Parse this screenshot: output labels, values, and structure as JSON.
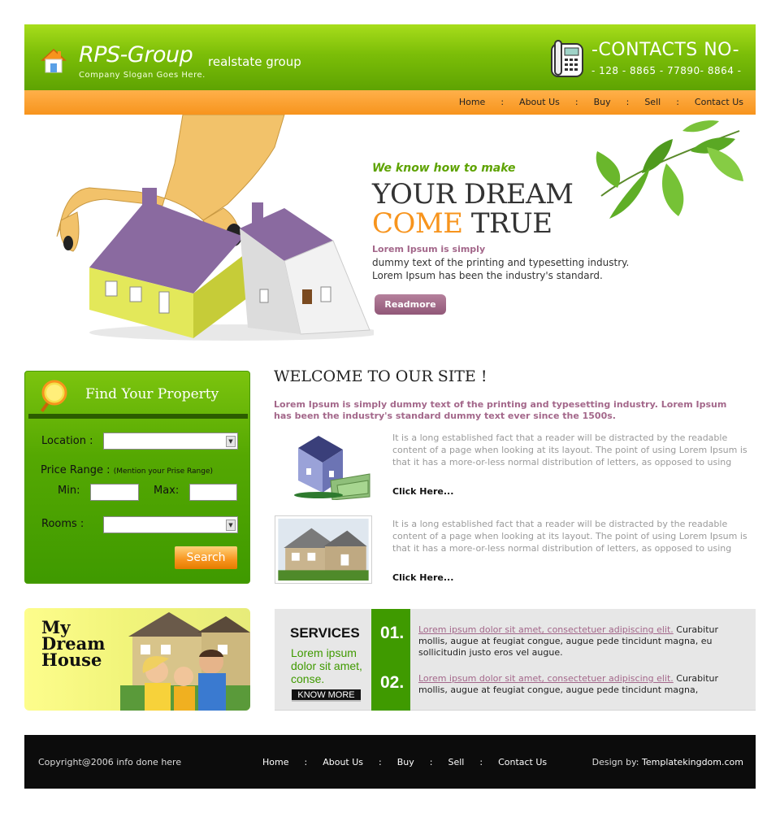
{
  "header": {
    "brand": "RPS-Group",
    "brand_sub": "realstate group",
    "slogan": "Company Slogan Goes Here.",
    "contacts_title": "-CONTACTS NO-",
    "contacts_number": "- 128 - 8865 - 77890- 8864 -"
  },
  "nav": [
    "Home",
    "About Us",
    "Buy",
    "Sell",
    "Contact Us"
  ],
  "hero": {
    "tagline": "We know how to make",
    "line1": "YOUR DREAM",
    "line2_orange": "COME",
    "line2_rest": " TRUE",
    "lorem_heading": "Lorem Ipsum is simply",
    "lorem_line1": "dummy text of the printing and typesetting industry.",
    "lorem_line2": "Lorem Ipsum has been the industry's standard.",
    "readmore": "Readmore"
  },
  "find": {
    "title": "Find Your Property",
    "location_label": "Location :",
    "price_label": "Price Range :",
    "price_hint": "(Mention your Prise Range)",
    "min_label": "Min:",
    "max_label": "Max:",
    "rooms_label": "Rooms :",
    "search": "Search"
  },
  "welcome": {
    "title": "WELCOME TO OUR SITE !",
    "intro": "Lorem Ipsum is simply dummy text of the printing and typesetting industry. Lorem Ipsum has been the industry's standard dummy text ever since the 1500s.",
    "items": [
      {
        "text": "It is a long established fact that a reader will be distracted by the readable content of a page when looking at its layout. The point of using Lorem Ipsum is that it has a more-or-less normal distribution of letters, as opposed to using",
        "link": "Click Here..."
      },
      {
        "text": "It is a long established fact that a reader will be distracted by the readable content of a page when looking at its layout. The point of using Lorem Ipsum is that it has a more-or-less normal distribution of letters, as opposed to using",
        "link": "Click Here..."
      }
    ]
  },
  "dream": {
    "line1": "My",
    "line2": "Dream",
    "line3": "House"
  },
  "services": {
    "title": "SERVICES",
    "subtitle": "Lorem ipsum dolor sit amet, conse.",
    "know_more": "KNOW MORE",
    "items": [
      {
        "num": "01.",
        "link": "Lorem ipsum dolor sit amet, consectetuer adipiscing elit.",
        "text": " Curabitur mollis, augue at feugiat congue, augue pede tincidunt magna, eu sollicitudin justo eros vel augue."
      },
      {
        "num": "02.",
        "link": "Lorem ipsum dolor sit amet, consectetuer adipiscing elit.",
        "text": " Curabitur mollis, augue at feugiat congue, augue pede tincidunt magna,"
      }
    ]
  },
  "footer": {
    "copyright": "Copyright@2006 info done here",
    "nav": [
      "Home",
      "About Us",
      "Buy",
      "Sell",
      "Contact Us"
    ],
    "design_prefix": "Design by: ",
    "design_name": "Templatekingdom.com"
  },
  "colors": {
    "green": "#5ea302",
    "orange": "#f7941d",
    "purple": "#a3678a",
    "footer": "#0c0c0c"
  }
}
